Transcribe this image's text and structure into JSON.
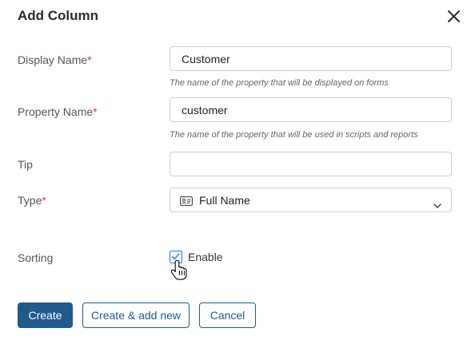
{
  "dialog": {
    "title": "Add Column",
    "close_icon": "close-icon"
  },
  "form": {
    "display_name": {
      "label": "Display Name",
      "required_mark": "*",
      "value": "Customer",
      "hint": "The name of the property that will be displayed on forms"
    },
    "property_name": {
      "label": "Property Name",
      "required_mark": "*",
      "value": "customer",
      "hint": "The name of the property that will be used in scripts and reports"
    },
    "tip": {
      "label": "Tip",
      "value": ""
    },
    "type": {
      "label": "Type",
      "required_mark": "*",
      "selected": "Full Name",
      "icon": "id-card-icon",
      "dropdown_icon": "chevron-down-icon"
    },
    "sorting": {
      "label": "Sorting",
      "checkbox_label": "Enable",
      "checked": true,
      "cursor_icon": "hand-cursor-icon"
    }
  },
  "buttons": {
    "create": "Create",
    "create_add_new": "Create & add new",
    "cancel": "Cancel"
  },
  "colors": {
    "primary": "#1f5a8d",
    "required": "#e03a34",
    "checkbox": "#3d7fc1"
  }
}
